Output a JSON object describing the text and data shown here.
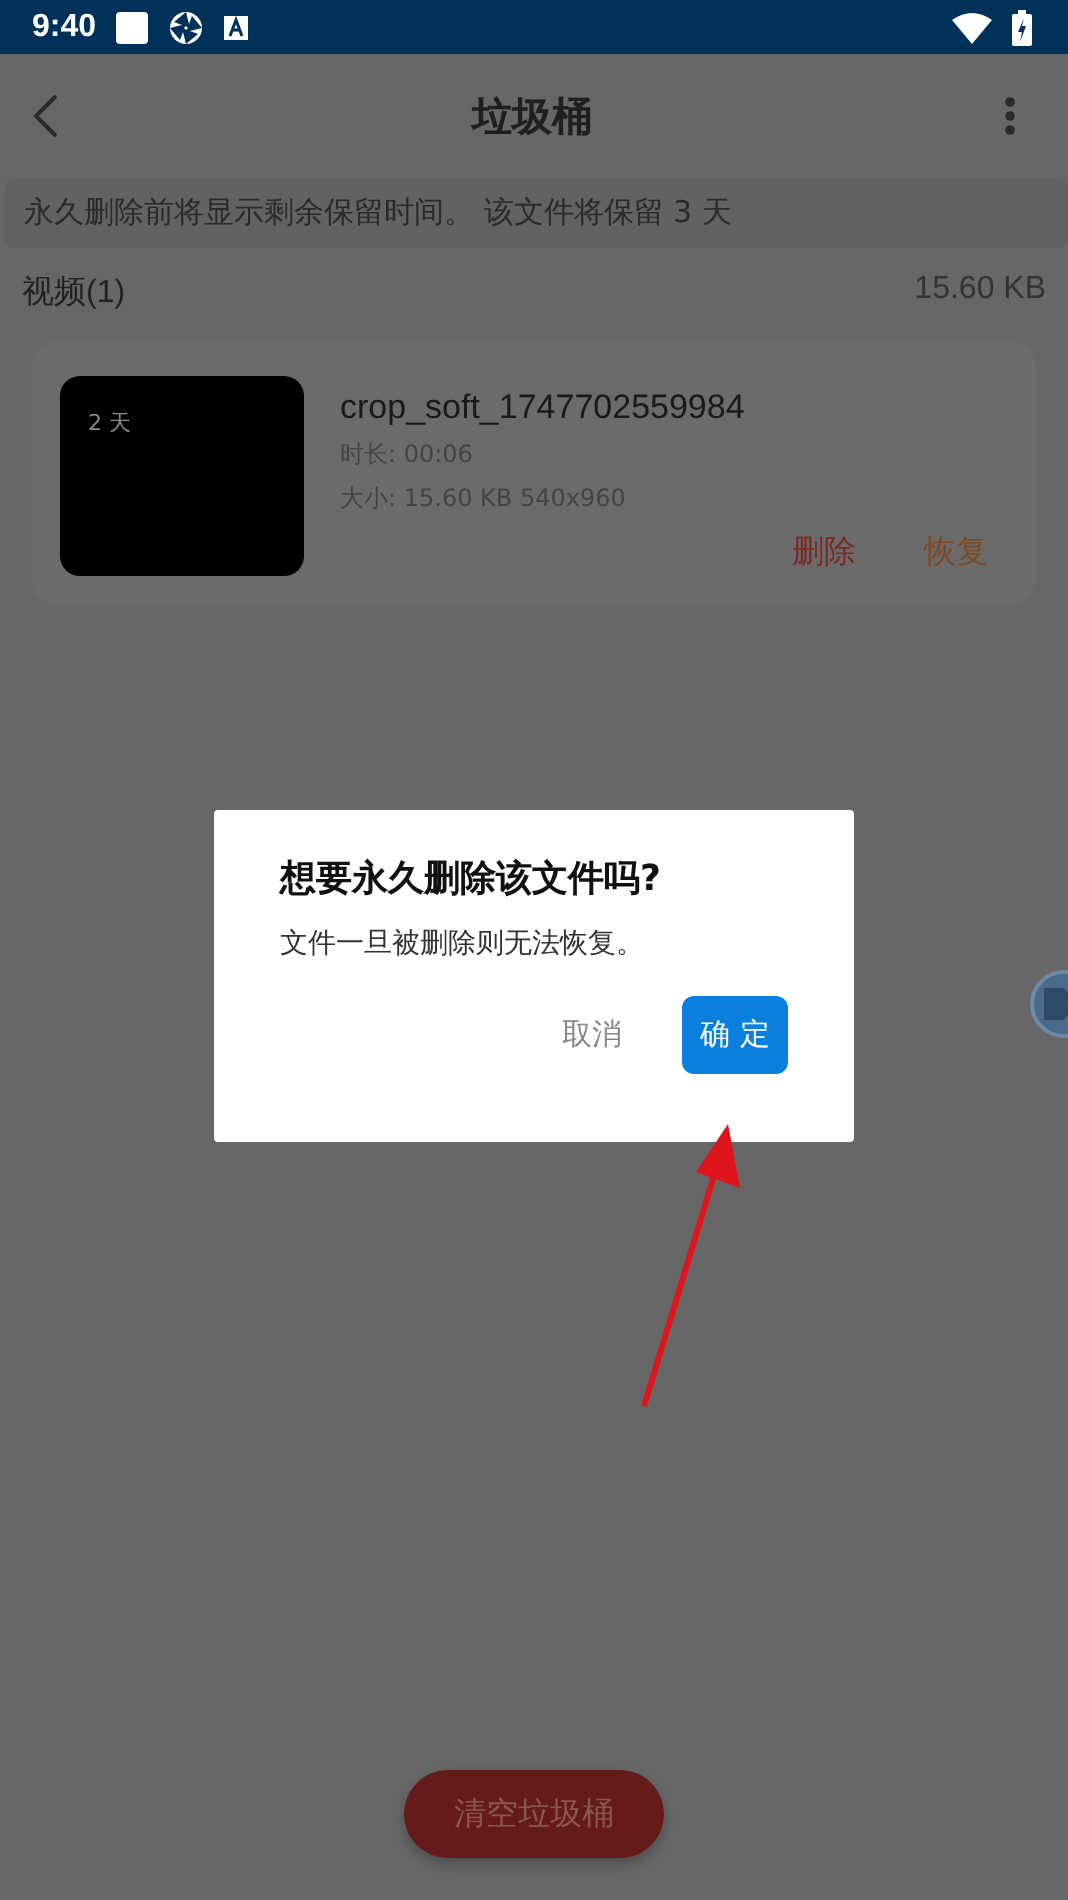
{
  "status_bar": {
    "time": "9:40"
  },
  "app_bar": {
    "title": "垃圾桶"
  },
  "notice": "永久删除前将显示剩余保留时间。 该文件将保留 3 天",
  "section": {
    "label": "视频(1)",
    "size": "15.60 KB"
  },
  "files": [
    {
      "thumbnail_badge": "2 天",
      "name": "crop_soft_1747702559984",
      "duration": "时长: 00:06",
      "size": "大小: 15.60 KB 540x960",
      "actions": [
        "删除",
        "恢复"
      ]
    }
  ],
  "empty_button": "清空垃圾桶",
  "dialog": {
    "title": "想要永久删除该文件吗?",
    "message": "文件一旦被删除则无法恢复。",
    "cancel": "取消",
    "confirm": "确 定"
  }
}
